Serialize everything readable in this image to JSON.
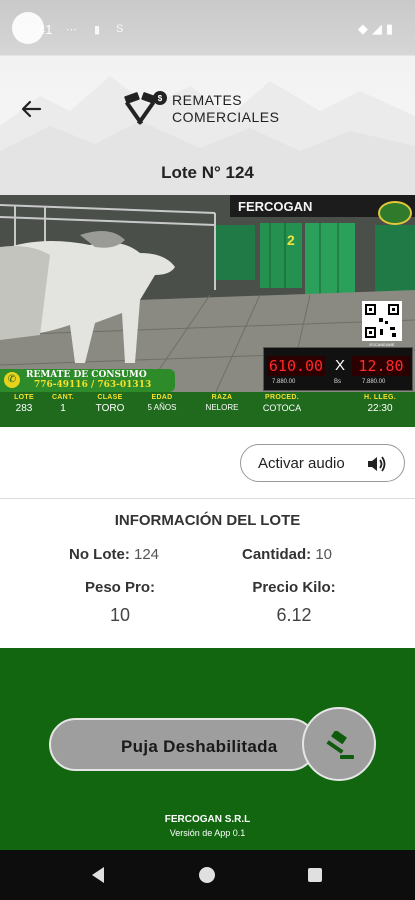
{
  "status_bar": {
    "time": "41",
    "icons": [
      "signal-icon",
      "wifi-icon",
      "battery-icon"
    ]
  },
  "header": {
    "brand_line1": "REMATES",
    "brand_line2": "COMERCIALES",
    "title": "Lote N° 124"
  },
  "video": {
    "sponsor": "FERCOGAN",
    "gate_number": "2",
    "banner_title": "REMATE DE CONSUMO",
    "banner_phones": "776-49116 / 763-01313",
    "qr_caption": "ESCANEAME",
    "price_left": "610.00",
    "price_x": "X",
    "price_right": "12.80",
    "price_left_sub": "7.880.00",
    "price_mid_sub": "Bs",
    "price_right_sub": "7.880.00",
    "ticker": [
      {
        "label": "LOTE",
        "value": "283"
      },
      {
        "label": "CANT.",
        "value": "1"
      },
      {
        "label": "CLASE",
        "value": "TORO"
      },
      {
        "label": "EDAD",
        "value": "5 AÑOS"
      },
      {
        "label": "RAZA",
        "value": "NELORE"
      },
      {
        "label": "PROCED.",
        "value": "COTOCA"
      },
      {
        "label": "H. LLEG.",
        "value": "22:30"
      }
    ]
  },
  "audio_button": {
    "label": "Activar audio"
  },
  "info": {
    "title": "INFORMACIÓN DEL LOTE",
    "no_lote_label": "No Lote:",
    "no_lote_value": "124",
    "cantidad_label": "Cantidad:",
    "cantidad_value": "10",
    "peso_label": "Peso Pro:",
    "peso_value": "10",
    "precio_label": "Precio Kilo:",
    "precio_value": "6.12"
  },
  "bid": {
    "label": "Puja Deshabilitada",
    "enabled": false
  },
  "footer": {
    "company": "FERCOGAN S.R.L",
    "version": "Versión de App 0.1"
  },
  "colors": {
    "green": "#12660f",
    "disabled_grey": "#9e9e9e",
    "price_red": "#ff2a2a"
  }
}
